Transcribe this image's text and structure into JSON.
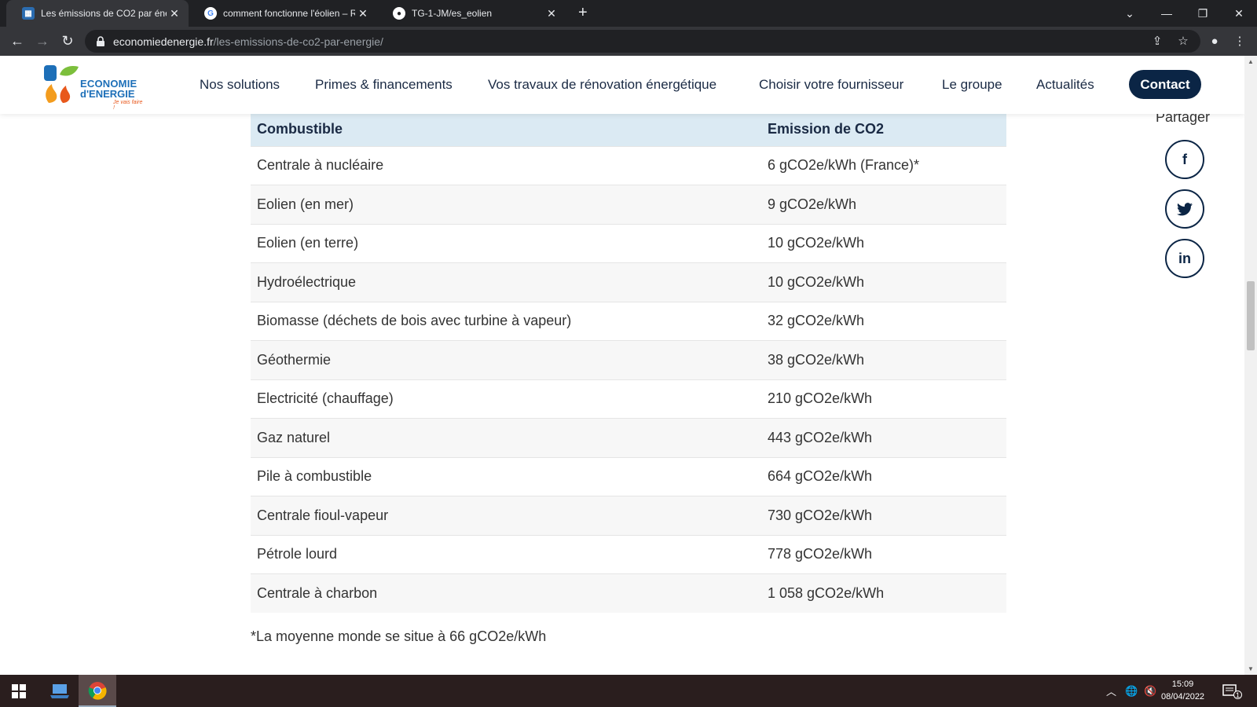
{
  "browser": {
    "tabs": [
      {
        "title": "Les émissions de CO2 par énergie",
        "favicon": "economie-favicon"
      },
      {
        "title": "comment fonctionne l'éolien – R",
        "favicon": "google-favicon"
      },
      {
        "title": "TG-1-JM/es_eolien",
        "favicon": "github-favicon"
      }
    ],
    "url_host": "economiedenergie.fr",
    "url_path": "/les-emissions-de-co2-par-energie/"
  },
  "site": {
    "logo_line1": "ECONOMIE",
    "logo_line2": "d'ENERGIE",
    "logo_tag": "Je vais faire !",
    "nav": [
      "Nos solutions",
      "Primes & financements",
      "Vos travaux de rénovation énergétique",
      "Choisir votre fournisseur",
      "Le groupe",
      "Actualités"
    ],
    "contact": "Contact"
  },
  "share": {
    "label": "Partager",
    "buttons": [
      {
        "glyph": "f",
        "icon": "facebook-icon"
      },
      {
        "glyph": "🐦",
        "icon": "twitter-icon"
      },
      {
        "glyph": "in",
        "icon": "linkedin-icon"
      }
    ]
  },
  "table": {
    "headers": [
      "Combustible",
      "Emission de CO2"
    ],
    "rows": [
      [
        "Centrale à nucléaire",
        "6 gCO2e/kWh (France)*"
      ],
      [
        "Eolien (en mer)",
        "9 gCO2e/kWh"
      ],
      [
        "Eolien (en terre)",
        "10 gCO2e/kWh"
      ],
      [
        "Hydroélectrique",
        "10 gCO2e/kWh"
      ],
      [
        "Biomasse (déchets de bois avec turbine à vapeur)",
        "32 gCO2e/kWh"
      ],
      [
        "Géothermie",
        "38 gCO2e/kWh"
      ],
      [
        "Electricité (chauffage)",
        "210 gCO2e/kWh"
      ],
      [
        "Gaz naturel",
        "443 gCO2e/kWh"
      ],
      [
        "Pile à combustible",
        "664 gCO2e/kWh"
      ],
      [
        "Centrale fioul-vapeur",
        "730 gCO2e/kWh"
      ],
      [
        "Pétrole lourd",
        "778 gCO2e/kWh"
      ],
      [
        "Centrale à charbon",
        "1 058 gCO2e/kWh"
      ]
    ]
  },
  "footnote": "*La moyenne monde se situe à 66 gCO2e/kWh",
  "taskbar": {
    "time": "15:09",
    "date": "08/04/2022",
    "notification_count": "1"
  },
  "colors": {
    "brand_navy": "#0b2545",
    "table_header_bg": "#dbeaf3",
    "row_alt_bg": "#f7f7f7"
  }
}
